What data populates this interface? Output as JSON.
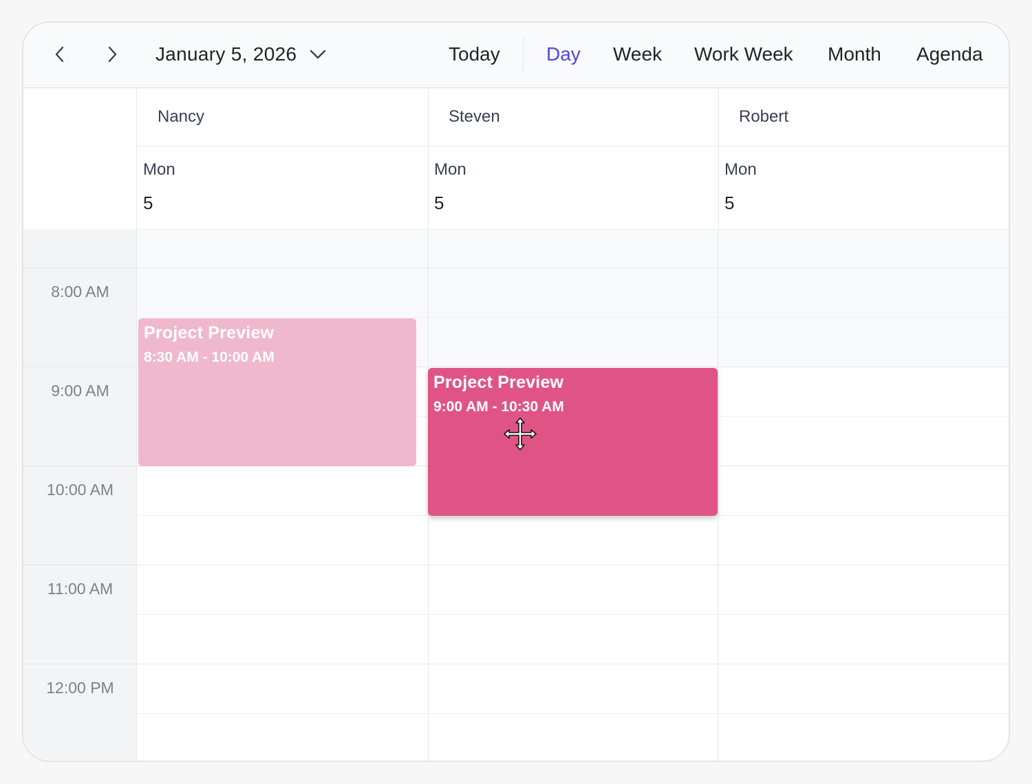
{
  "toolbar": {
    "prev_icon": "chevron-left-icon",
    "next_icon": "chevron-right-icon",
    "date_label": "January 5, 2026",
    "dropdown_icon": "chevron-down-icon",
    "today_label": "Today",
    "views": [
      {
        "label": "Day",
        "active": true
      },
      {
        "label": "Week",
        "active": false
      },
      {
        "label": "Work Week",
        "active": false
      },
      {
        "label": "Month",
        "active": false
      },
      {
        "label": "Agenda",
        "active": false
      }
    ],
    "accent_color": "#4f46e5"
  },
  "resources": [
    {
      "name": "Nancy",
      "day_name": "Mon",
      "day_number": "5"
    },
    {
      "name": "Steven",
      "day_name": "Mon",
      "day_number": "5"
    },
    {
      "name": "Robert",
      "day_name": "Mon",
      "day_number": "5"
    }
  ],
  "time_labels": [
    "8:00 AM",
    "9:00 AM",
    "10:00 AM",
    "11:00 AM",
    "12:00 PM"
  ],
  "events": [
    {
      "title": "Project Preview",
      "time": "8:30 AM - 10:00 AM",
      "resource": "Nancy",
      "state": "drag-origin",
      "color": "#f0b8cc"
    },
    {
      "title": "Project Preview",
      "time": "9:00 AM - 10:30 AM",
      "resource": "Steven",
      "state": "dragging",
      "color": "#df5485"
    }
  ],
  "cursor_icon": "move-cursor-icon"
}
